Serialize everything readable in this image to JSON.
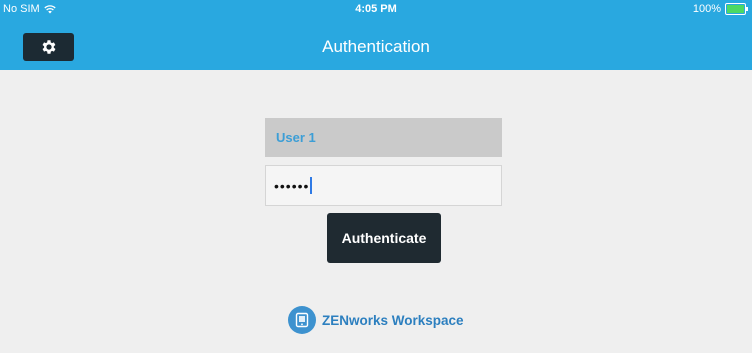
{
  "status_bar": {
    "carrier": "No SIM",
    "time": "4:05 PM",
    "battery": "100%",
    "wifi_icon": "wifi-icon",
    "battery_icon": "battery-icon"
  },
  "nav": {
    "title": "Authentication",
    "settings_icon": "gear-icon"
  },
  "form": {
    "username_value": "User 1",
    "password_value": "••••••",
    "authenticate_label": "Authenticate"
  },
  "brand": {
    "name": "ZENworks Workspace",
    "logo_icon": "zenworks-logo-icon"
  },
  "colors": {
    "header": "#29a8e0",
    "background": "#efefef",
    "button": "#1f2a31",
    "username_text": "#3c9ed6",
    "brand_text": "#2c7fbf"
  }
}
